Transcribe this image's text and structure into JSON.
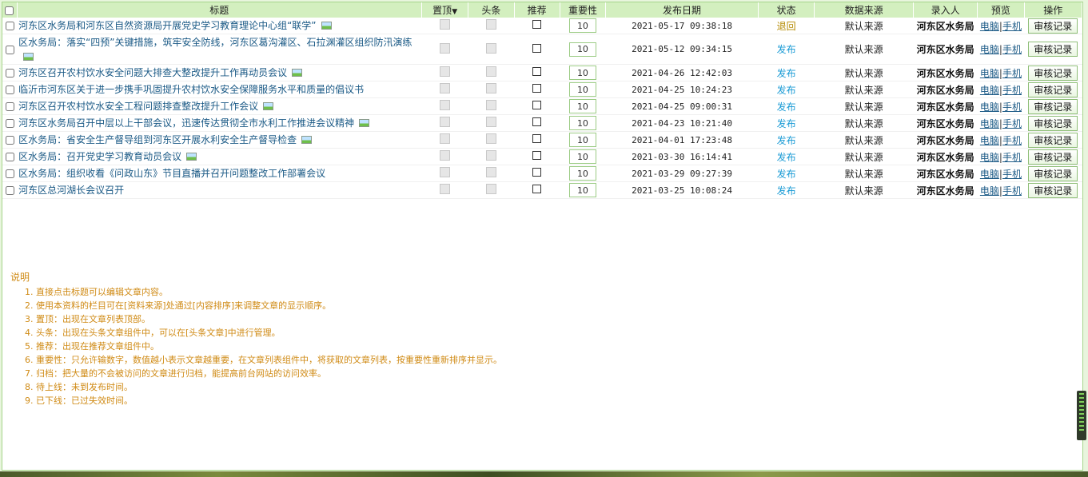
{
  "columns": {
    "title": "标题",
    "top": "置顶",
    "sort_arrow": "▼",
    "headline": "头条",
    "recommend": "推荐",
    "importance": "重要性",
    "date": "发布日期",
    "status": "状态",
    "source": "数据来源",
    "author": "录入人",
    "preview": "预览",
    "action": "操作"
  },
  "rows": [
    {
      "title": "河东区水务局和河东区自然资源局开展党史学习教育理论中心组“联学”",
      "importance": "10",
      "date": "2021-05-17 09:38:18",
      "status": "退回",
      "source": "默认来源",
      "author": "河东区水务局",
      "pc": "电脑",
      "mobile": "手机",
      "action": "审核记录",
      "tall": false
    },
    {
      "title": "区水务局：落实“四预”关键措施，筑牢安全防线，河东区葛沟灌区、石拉渊灌区组织防汛演练",
      "importance": "10",
      "date": "2021-05-12 09:34:15",
      "status": "发布",
      "source": "默认来源",
      "author": "河东区水务局",
      "pc": "电脑",
      "mobile": "手机",
      "action": "审核记录",
      "tall": true
    },
    {
      "title": "河东区召开农村饮水安全问题大排查大整改提升工作再动员会议",
      "importance": "10",
      "date": "2021-04-26 12:42:03",
      "status": "发布",
      "source": "默认来源",
      "author": "河东区水务局",
      "pc": "电脑",
      "mobile": "手机",
      "action": "审核记录",
      "tall": false
    },
    {
      "title": "临沂市河东区关于进一步携手巩固提升农村饮水安全保障服务水平和质量的倡议书",
      "importance": "10",
      "date": "2021-04-25 10:24:23",
      "status": "发布",
      "source": "默认来源",
      "author": "河东区水务局",
      "pc": "电脑",
      "mobile": "手机",
      "action": "审核记录",
      "tall": false,
      "noimg": true
    },
    {
      "title": "河东区召开农村饮水安全工程问题排查整改提升工作会议",
      "importance": "10",
      "date": "2021-04-25 09:00:31",
      "status": "发布",
      "source": "默认来源",
      "author": "河东区水务局",
      "pc": "电脑",
      "mobile": "手机",
      "action": "审核记录",
      "tall": false
    },
    {
      "title": "河东区水务局召开中层以上干部会议，迅速传达贯彻全市水利工作推进会议精神",
      "importance": "10",
      "date": "2021-04-23 10:21:40",
      "status": "发布",
      "source": "默认来源",
      "author": "河东区水务局",
      "pc": "电脑",
      "mobile": "手机",
      "action": "审核记录",
      "tall": false
    },
    {
      "title": "区水务局：省安全生产督导组到河东区开展水利安全生产督导检查",
      "importance": "10",
      "date": "2021-04-01 17:23:48",
      "status": "发布",
      "source": "默认来源",
      "author": "河东区水务局",
      "pc": "电脑",
      "mobile": "手机",
      "action": "审核记录",
      "tall": false
    },
    {
      "title": "区水务局：召开党史学习教育动员会议",
      "importance": "10",
      "date": "2021-03-30 16:14:41",
      "status": "发布",
      "source": "默认来源",
      "author": "河东区水务局",
      "pc": "电脑",
      "mobile": "手机",
      "action": "审核记录",
      "tall": false
    },
    {
      "title": "区水务局：组织收看《问政山东》节目直播并召开问题整改工作部署会议",
      "importance": "10",
      "date": "2021-03-29 09:27:39",
      "status": "发布",
      "source": "默认来源",
      "author": "河东区水务局",
      "pc": "电脑",
      "mobile": "手机",
      "action": "审核记录",
      "tall": false,
      "noimg": true
    },
    {
      "title": "河东区总河湖长会议召开",
      "importance": "10",
      "date": "2021-03-25 10:08:24",
      "status": "发布",
      "source": "默认来源",
      "author": "河东区水务局",
      "pc": "电脑",
      "mobile": "手机",
      "action": "审核记录",
      "tall": false,
      "noimg": true
    }
  ],
  "notes": {
    "heading": "说明",
    "items": [
      "直接点击标题可以编辑文章内容。",
      "使用本资料的栏目可在[资料来源]处通过[内容排序]来调整文章的显示顺序。",
      "置顶：出现在文章列表顶部。",
      "头条：出现在头条文章组件中，可以在[头条文章]中进行管理。",
      "推荐：出现在推荐文章组件中。",
      "重要性：只允许输数字，数值越小表示文章越重要，在文章列表组件中，将获取的文章列表，按重要性重新排序并显示。",
      "归档：把大量的不会被访问的文章进行归档，能提高前台网站的访问效率。",
      "待上线：未到发布时间。",
      "已下线：已过失效时间。"
    ]
  },
  "colors": {
    "header_bg": "#d3efbf",
    "published": "#1a9bd5",
    "returned": "#b58a00",
    "notes": "#d08b16",
    "link": "#1b5a86"
  }
}
